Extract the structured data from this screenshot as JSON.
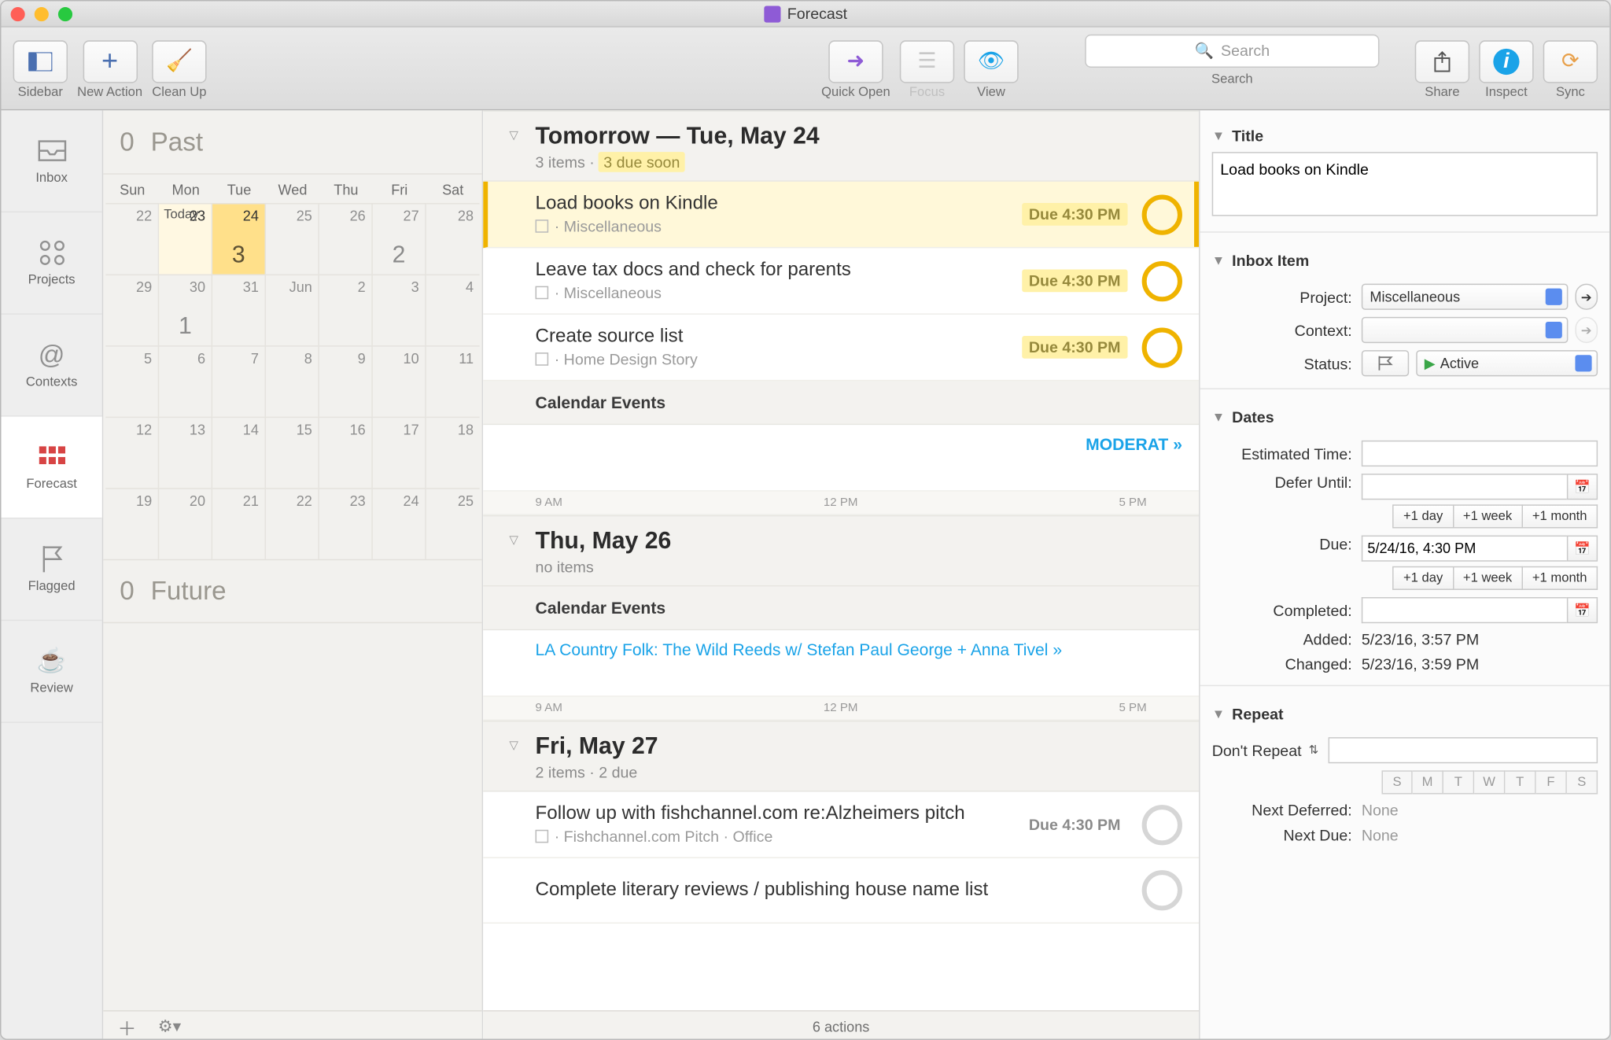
{
  "window_title": "Forecast",
  "toolbar": {
    "sidebar": "Sidebar",
    "new_action": "New Action",
    "clean_up": "Clean Up",
    "quick_open": "Quick Open",
    "focus": "Focus",
    "view": "View",
    "search_placeholder": "Search",
    "search_label": "Search",
    "share": "Share",
    "inspect": "Inspect",
    "sync": "Sync"
  },
  "sidebar": {
    "items": [
      {
        "label": "Inbox"
      },
      {
        "label": "Projects"
      },
      {
        "label": "Contexts"
      },
      {
        "label": "Forecast"
      },
      {
        "label": "Flagged"
      },
      {
        "label": "Review"
      }
    ]
  },
  "calpane": {
    "past_count": "0",
    "past_label": "Past",
    "future_count": "0",
    "future_label": "Future",
    "dow": [
      "Sun",
      "Mon",
      "Tue",
      "Wed",
      "Thu",
      "Fri",
      "Sat"
    ],
    "today_label": "Today",
    "cells": [
      {
        "n": "22"
      },
      {
        "n": "23",
        "today": true,
        "label": "Today"
      },
      {
        "n": "24",
        "sel": true,
        "cnt": "3"
      },
      {
        "n": "25"
      },
      {
        "n": "26"
      },
      {
        "n": "27",
        "cnt": "2"
      },
      {
        "n": "28"
      },
      {
        "n": "29"
      },
      {
        "n": "30",
        "cnt": "1"
      },
      {
        "n": "31"
      },
      {
        "n": "Jun"
      },
      {
        "n": "2"
      },
      {
        "n": "3"
      },
      {
        "n": "4"
      },
      {
        "n": "5"
      },
      {
        "n": "6"
      },
      {
        "n": "7"
      },
      {
        "n": "8"
      },
      {
        "n": "9"
      },
      {
        "n": "10"
      },
      {
        "n": "11"
      },
      {
        "n": "12"
      },
      {
        "n": "13"
      },
      {
        "n": "14"
      },
      {
        "n": "15"
      },
      {
        "n": "16"
      },
      {
        "n": "17"
      },
      {
        "n": "18"
      },
      {
        "n": "19"
      },
      {
        "n": "20"
      },
      {
        "n": "21"
      },
      {
        "n": "22"
      },
      {
        "n": "23"
      },
      {
        "n": "24"
      },
      {
        "n": "25"
      }
    ]
  },
  "days": [
    {
      "title": "Tomorrow — Tue, May 24",
      "sub": "3 items ·",
      "soon": "3 due soon",
      "hl": true,
      "tasks": [
        {
          "title": "Load books on Kindle",
          "proj": "Miscellaneous",
          "due": "Due 4:30 PM",
          "hl": true,
          "duesoon": true
        },
        {
          "title": "Leave tax docs and check for parents",
          "proj": "Miscellaneous",
          "due": "Due 4:30 PM",
          "duesoon": true
        },
        {
          "title": "Create source list",
          "proj": "Home Design Story",
          "due": "Due 4:30 PM",
          "duesoon": true
        }
      ],
      "calevents_label": "Calendar Events",
      "event": "MODERAT »",
      "times": [
        "9 AM",
        "12 PM",
        "5 PM"
      ]
    },
    {
      "title": "Thu, May 26",
      "sub": "no items",
      "tasks": [],
      "calevents_label": "Calendar Events",
      "event2": "LA Country Folk: The Wild Reeds w/ Stefan Paul George + Anna Tivel »",
      "times": [
        "9 AM",
        "12 PM",
        "5 PM"
      ]
    },
    {
      "title": "Fri, May 27",
      "sub": "2 items · 2 due",
      "tasks": [
        {
          "title": "Follow up with fishchannel.com re:Alzheimers pitch",
          "proj": "Fishchannel.com Pitch · Office",
          "due": "Due 4:30 PM",
          "gray": true
        },
        {
          "title": "Complete literary reviews / publishing house name list",
          "proj": "",
          "due": "",
          "gray": true
        }
      ]
    }
  ],
  "statusbar": {
    "actions": "6 actions"
  },
  "inspector": {
    "title_hdr": "Title",
    "title_value": "Load books on Kindle",
    "inbox_hdr": "Inbox Item",
    "project_lbl": "Project:",
    "project_val": "Miscellaneous",
    "context_lbl": "Context:",
    "context_val": "",
    "status_lbl": "Status:",
    "status_val": "Active",
    "dates_hdr": "Dates",
    "est_lbl": "Estimated Time:",
    "defer_lbl": "Defer Until:",
    "due_lbl": "Due:",
    "due_val": "5/24/16, 4:30 PM",
    "seg": [
      "+1 day",
      "+1 week",
      "+1 month"
    ],
    "completed_lbl": "Completed:",
    "added_lbl": "Added:",
    "added_val": "5/23/16, 3:57 PM",
    "changed_lbl": "Changed:",
    "changed_val": "5/23/16, 3:59 PM",
    "repeat_hdr": "Repeat",
    "repeat_mode": "Don't Repeat",
    "dow": [
      "S",
      "M",
      "T",
      "W",
      "T",
      "F",
      "S"
    ],
    "next_def_lbl": "Next Deferred:",
    "next_def_val": "None",
    "next_due_lbl": "Next Due:",
    "next_due_val": "None"
  }
}
